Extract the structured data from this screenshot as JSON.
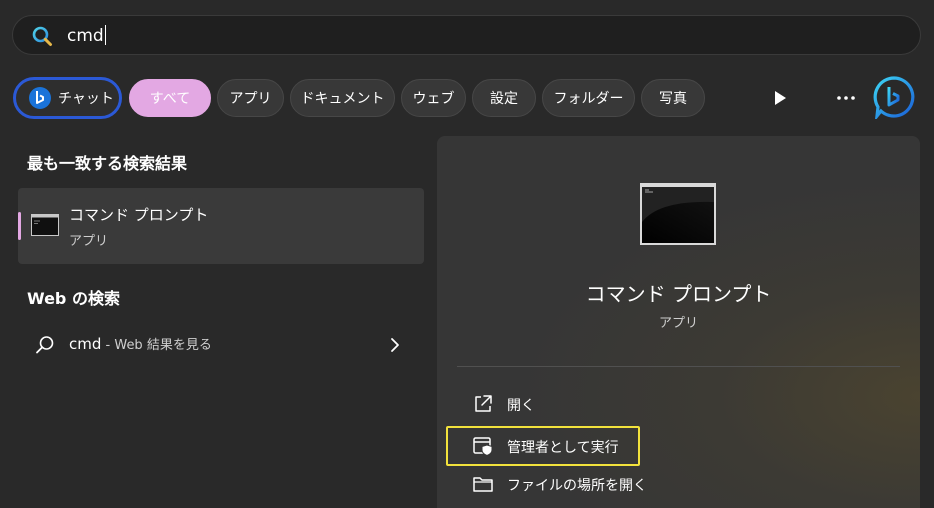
{
  "search": {
    "query": "cmd"
  },
  "chips": {
    "chat": "チャット",
    "all": "すべて",
    "apps": "アプリ",
    "documents": "ドキュメント",
    "web": "ウェブ",
    "settings": "設定",
    "folders": "フォルダー",
    "photos": "写真"
  },
  "colors": {
    "accent_pink": "#e3a8e3",
    "chat_border": "#2b59d6",
    "highlight_yellow": "#f2e23c",
    "background": "#292929"
  },
  "icons": {
    "search": "search-icon",
    "bing": "bing-icon",
    "play": "play-icon",
    "more": "more-icon",
    "cmd": "command-prompt-icon",
    "open": "open-external-icon",
    "admin": "shield-window-icon",
    "folder": "folder-icon",
    "chevron": "chevron-right-icon"
  },
  "best_match": {
    "heading": "最も一致する検索結果",
    "title": "コマンド プロンプト",
    "subtitle": "アプリ"
  },
  "web_search": {
    "heading": "Web の検索",
    "query": "cmd",
    "suffix": " - Web 結果を見る"
  },
  "preview": {
    "title": "コマンド プロンプト",
    "subtitle": "アプリ",
    "actions": {
      "open": "開く",
      "run_as_admin": "管理者として実行",
      "open_file_location": "ファイルの場所を開く"
    }
  }
}
